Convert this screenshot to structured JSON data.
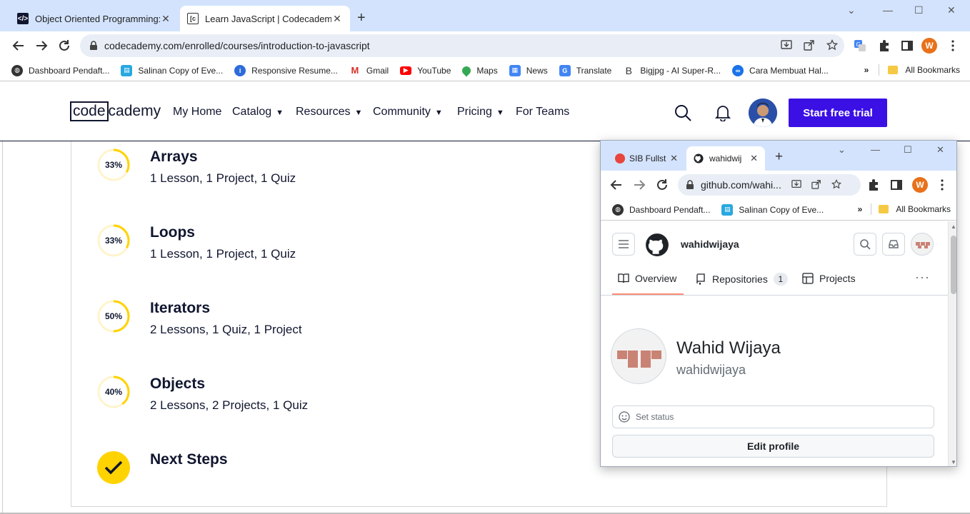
{
  "main_browser": {
    "tabs": [
      {
        "title": "Object Oriented Programming: C",
        "favicon": "codecademy-favicon",
        "active": false
      },
      {
        "title": "Learn JavaScript | Codecademy",
        "favicon": "codecademy-favicon",
        "active": true
      }
    ],
    "url": "codecademy.com/enrolled/courses/introduction-to-javascript",
    "profile_initial": "W",
    "bookmarks": [
      {
        "label": "Dashboard Pendaft...",
        "icon": "globe-icon"
      },
      {
        "label": "Salinan Copy of Eve...",
        "icon": "sheets-icon"
      },
      {
        "label": "Responsive Resume...",
        "icon": "resume-icon"
      },
      {
        "label": "Gmail",
        "icon": "gmail-icon"
      },
      {
        "label": "YouTube",
        "icon": "youtube-icon"
      },
      {
        "label": "Maps",
        "icon": "maps-icon"
      },
      {
        "label": "News",
        "icon": "news-icon"
      },
      {
        "label": "Translate",
        "icon": "translate-icon"
      },
      {
        "label": "Bigjpg - AI Super-R...",
        "icon": "bigjpg-icon"
      },
      {
        "label": "Cara Membuat Hal...",
        "icon": "link-icon"
      }
    ],
    "all_bookmarks": "All Bookmarks"
  },
  "codecademy": {
    "logo_left": "code",
    "logo_right": "cademy",
    "nav": [
      {
        "label": "My Home",
        "dropdown": false
      },
      {
        "label": "Catalog",
        "dropdown": true
      },
      {
        "label": "Resources",
        "dropdown": true
      },
      {
        "label": "Community",
        "dropdown": true
      },
      {
        "label": "Pricing",
        "dropdown": true
      },
      {
        "label": "For Teams",
        "dropdown": false
      }
    ],
    "trial_button": "Start free trial",
    "modules": [
      {
        "title": "Arrays",
        "details": "1 Lesson, 1 Project, 1 Quiz",
        "progress_label": "33%",
        "progress": 0.33
      },
      {
        "title": "Loops",
        "details": "1 Lesson, 1 Project, 1 Quiz",
        "progress_label": "33%",
        "progress": 0.33
      },
      {
        "title": "Iterators",
        "details": "2 Lessons, 1 Quiz, 1 Project",
        "progress_label": "50%",
        "progress": 0.5
      },
      {
        "title": "Objects",
        "details": "2 Lessons, 2 Projects, 1 Quiz",
        "progress_label": "40%",
        "progress": 0.4
      },
      {
        "title": "Next Steps",
        "details": "",
        "progress_label": "",
        "progress": 1.0
      }
    ],
    "colors": {
      "brand": "#10162f",
      "trial": "#3a10e5",
      "progress": "#ffd300",
      "progress_track": "#fff4cc"
    }
  },
  "popup_browser": {
    "tabs": [
      {
        "title": "SIB Fullst",
        "favicon": "codecademy-favicon",
        "active": false
      },
      {
        "title": "wahidwij",
        "favicon": "github-icon",
        "active": true
      }
    ],
    "url": "github.com/wahi...",
    "profile_initial": "W",
    "bookmarks": [
      {
        "label": "Dashboard Pendaft...",
        "icon": "globe-icon"
      },
      {
        "label": "Salinan Copy of Eve...",
        "icon": "sheets-icon"
      }
    ],
    "all_bookmarks": "All Bookmarks"
  },
  "github": {
    "username_header": "wahidwijaya",
    "tabs": [
      {
        "label": "Overview",
        "icon": "book-icon",
        "selected": true
      },
      {
        "label": "Repositories",
        "icon": "repo-icon",
        "count": "1"
      },
      {
        "label": "Projects",
        "icon": "table-icon"
      }
    ],
    "full_name": "Wahid Wijaya",
    "login": "wahidwijaya",
    "set_status": "Set status",
    "edit_profile": "Edit profile",
    "colors": {
      "underline": "#fd8c73",
      "identicon": "#c98375"
    }
  }
}
